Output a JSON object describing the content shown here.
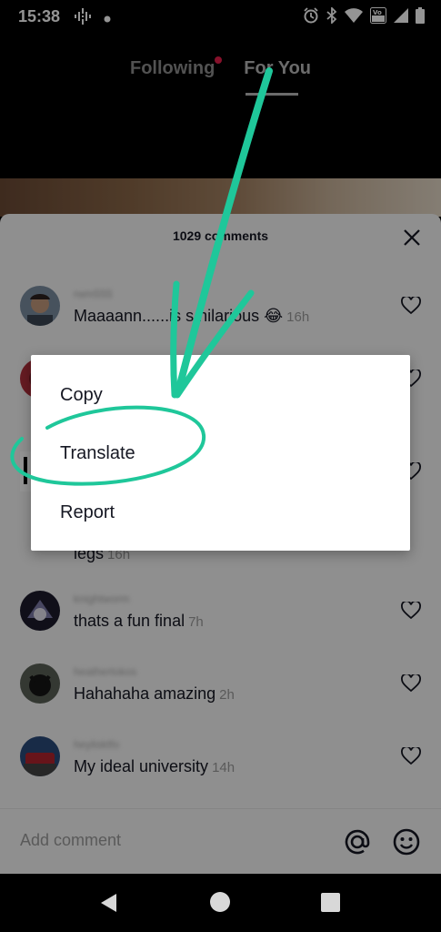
{
  "status_bar": {
    "time": "15:38",
    "left_icons": [
      "podcast-icon",
      "notification-dot-icon"
    ],
    "right_icons": [
      "alarm-icon",
      "bluetooth-icon",
      "wifi-icon",
      "volte-icon",
      "signal-icon",
      "battery-icon"
    ]
  },
  "feed_tabs": [
    {
      "label": "Following",
      "has_dot": true
    },
    {
      "label": "For You",
      "active": true
    }
  ],
  "comments_panel": {
    "count_label": "1029 comments",
    "comments": [
      {
        "username": "rwm555",
        "text": "Maaaann......is s hilarious 😂",
        "time": "16h"
      },
      {
        "username": "",
        "text": "legs",
        "time": "16h"
      },
      {
        "username": "knightworm",
        "text": "thats a fun final",
        "time": "7h"
      },
      {
        "username": "heathertokos",
        "text": "Hahahaha amazing",
        "time": "2h"
      },
      {
        "username": "heylisktfo",
        "text": "My ideal university",
        "time": "14h"
      }
    ],
    "add_comment_placeholder": "Add comment"
  },
  "context_menu": {
    "items": [
      "Copy",
      "Translate",
      "Report"
    ]
  },
  "colors": {
    "annotation": "#1fc79a",
    "sheet_bg": "#f6f6f6",
    "tab_dot": "#e91e4b"
  }
}
